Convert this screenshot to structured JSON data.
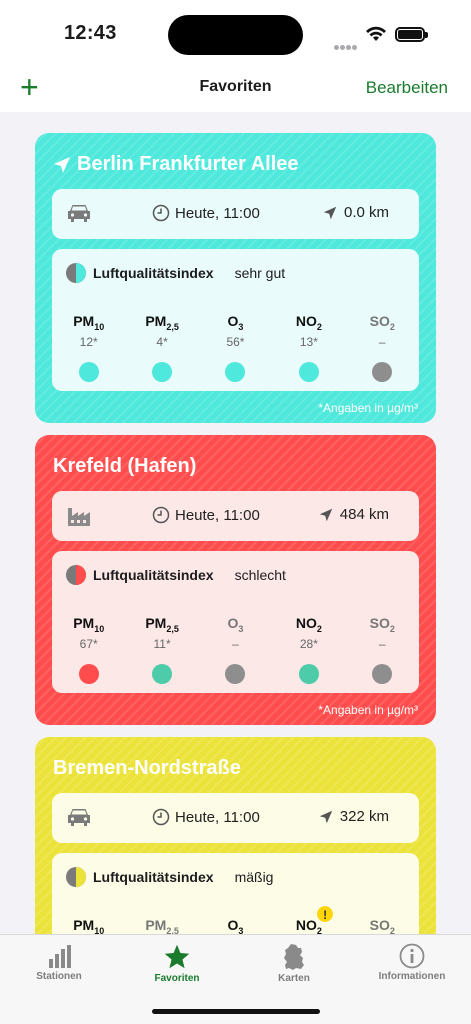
{
  "status": {
    "time": "12:43"
  },
  "nav": {
    "add": "+",
    "title": "Favoriten",
    "edit": "Bearbeiten"
  },
  "units_note": "*Angaben in µg/m³",
  "cards": [
    {
      "title": "Berlin Frankfurter Allee",
      "color": "#4fe8dc",
      "panel_color": "#e9fbfa",
      "has_location_arrow": true,
      "station_type_icon": "car-icon",
      "time": "Heute, 11:00",
      "distance": "0.0 km",
      "aq_label": "Luftqualitätsindex",
      "aq_value": "sehr gut",
      "pollutants": [
        {
          "name": "PM",
          "sub": "10",
          "value": "12*",
          "color": "#4fe8dc",
          "dim": false
        },
        {
          "name": "PM",
          "sub": "2,5",
          "value": "4*",
          "color": "#4fe8dc",
          "dim": false
        },
        {
          "name": "O",
          "sub": "3",
          "value": "56*",
          "color": "#4fe8dc",
          "dim": false
        },
        {
          "name": "NO",
          "sub": "2",
          "value": "13*",
          "color": "#4fe8dc",
          "dim": false
        },
        {
          "name": "SO",
          "sub": "2",
          "value": "–",
          "color": "#8e8e8e",
          "dim": true
        }
      ]
    },
    {
      "title": "Krefeld (Hafen)",
      "color": "#ff4c4c",
      "panel_color": "#fde8e8",
      "has_location_arrow": false,
      "station_type_icon": "factory-icon",
      "time": "Heute, 11:00",
      "distance": "484 km",
      "aq_label": "Luftqualitätsindex",
      "aq_value": "schlecht",
      "pollutants": [
        {
          "name": "PM",
          "sub": "10",
          "value": "67*",
          "color": "#ff4c4c",
          "dim": false
        },
        {
          "name": "PM",
          "sub": "2,5",
          "value": "11*",
          "color": "#4ecba9",
          "dim": false
        },
        {
          "name": "O",
          "sub": "3",
          "value": "–",
          "color": "#8e8e8e",
          "dim": true
        },
        {
          "name": "NO",
          "sub": "2",
          "value": "28*",
          "color": "#4ecba9",
          "dim": false
        },
        {
          "name": "SO",
          "sub": "2",
          "value": "–",
          "color": "#8e8e8e",
          "dim": true
        }
      ]
    },
    {
      "title": "Bremen-Nordstraße",
      "color": "#ece33a",
      "panel_color": "#fdfce6",
      "has_location_arrow": false,
      "station_type_icon": "car-icon",
      "time": "Heute, 11:00",
      "distance": "322 km",
      "aq_label": "Luftqualitätsindex",
      "aq_value": "mäßig",
      "pollutants": [
        {
          "name": "PM",
          "sub": "10",
          "value": "",
          "color": "#ece33a",
          "dim": false
        },
        {
          "name": "PM",
          "sub": "2,5",
          "value": "",
          "color": "#ece33a",
          "dim": true
        },
        {
          "name": "O",
          "sub": "3",
          "value": "",
          "color": "#ece33a",
          "dim": false
        },
        {
          "name": "NO",
          "sub": "2",
          "value": "",
          "color": "#ece33a",
          "dim": false,
          "warning": "!"
        },
        {
          "name": "SO",
          "sub": "2",
          "value": "",
          "color": "#8e8e8e",
          "dim": true
        }
      ]
    }
  ],
  "tabs": [
    {
      "label": "Stationen",
      "icon": "bar-chart-icon",
      "active": false
    },
    {
      "label": "Favoriten",
      "icon": "star-icon",
      "active": true
    },
    {
      "label": "Karten",
      "icon": "germany-map-icon",
      "active": false
    },
    {
      "label": "Informationen",
      "icon": "info-icon",
      "active": false
    }
  ]
}
